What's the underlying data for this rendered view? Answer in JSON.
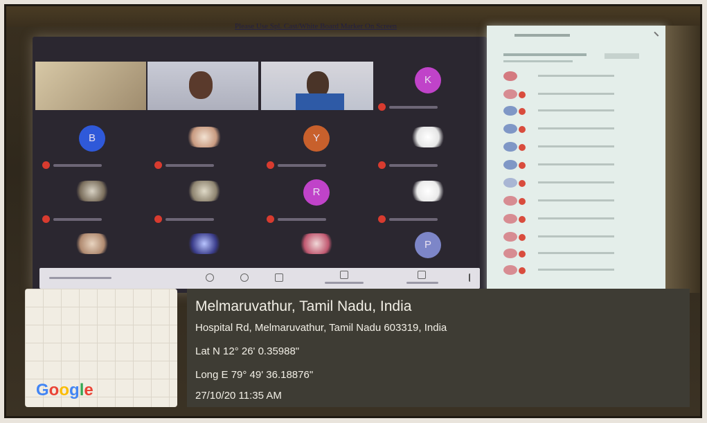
{
  "banner": {
    "text": "Please Use Spl. Cast/White Board Marker On Screen"
  },
  "meeting": {
    "gallery_avatar_letters": [
      "K",
      "B",
      "Y",
      "R",
      "P"
    ],
    "colors": {
      "mic_off": "#d83b2f",
      "avatar_purple": "#c043c9",
      "avatar_blue": "#2f59d9",
      "avatar_orange": "#c8602c"
    }
  },
  "location_stamp": {
    "place": "Melmaruvathur, Tamil Nadu, India",
    "address": "Hospital Rd, Melmaruvathur, Tamil Nadu 603319, India",
    "lat": "Lat N 12° 26' 0.35988\"",
    "long": "Long E 79° 49' 36.18876\"",
    "datetime": "27/10/20 11:35 AM"
  },
  "google": {
    "logo_text": "Google"
  }
}
